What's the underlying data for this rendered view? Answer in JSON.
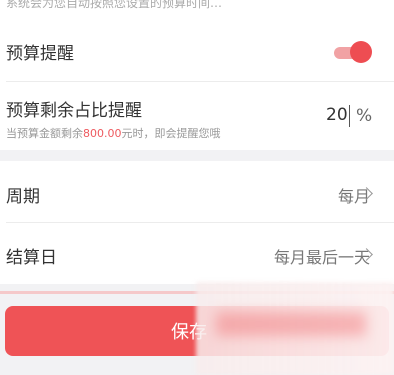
{
  "top_hint": "系统会为您自动按照您设置的预算时间…",
  "budget_reminder": {
    "label": "预算提醒",
    "enabled": true
  },
  "remaining_ratio": {
    "label": "预算剩余占比提醒",
    "value": "20",
    "unit": "%",
    "hint_prefix": "当预算金额剩余",
    "hint_amount": "800.00",
    "hint_suffix": "元时，即会提醒您哦"
  },
  "period": {
    "label": "周期",
    "value": "每月"
  },
  "settlement_day": {
    "label": "结算日",
    "value": "每月最后一天"
  },
  "save_button": {
    "label": "保存"
  },
  "colors": {
    "accent": "#ef5356",
    "toggle_track": "#f1a2a4",
    "background": "#f2f2f4"
  }
}
